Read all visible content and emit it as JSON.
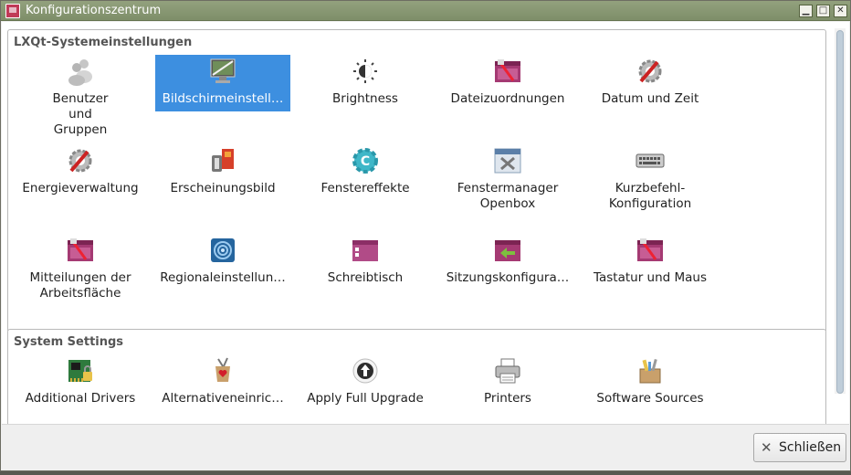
{
  "window": {
    "title": "Konfigurationszentrum",
    "buttons": {
      "minimize": "▁",
      "maximize": "□",
      "close": "✕"
    }
  },
  "sections": [
    {
      "title": "LXQt-Systemeinstellungen",
      "items": [
        {
          "label": "Benutzer und Gruppen",
          "icon": "users-icon"
        },
        {
          "label": "Bildschirmeinstell…",
          "icon": "monitor-icon",
          "selected": true
        },
        {
          "label": "Brightness",
          "icon": "brightness-icon"
        },
        {
          "label": "Dateizuordnungen",
          "icon": "preferences-icon"
        },
        {
          "label": "Datum und Zeit",
          "icon": "tools-icon"
        },
        {
          "label": "Energieverwaltung",
          "icon": "tools-icon"
        },
        {
          "label": "Erscheinungsbild",
          "icon": "appearance-icon"
        },
        {
          "label": "Fenstereffekte",
          "icon": "gear-icon"
        },
        {
          "label": "Fenstermanager Openbox",
          "icon": "window-manager-icon"
        },
        {
          "label": "Kurzbefehl-Konfiguration",
          "icon": "keyboard-icon"
        },
        {
          "label": "Mitteilungen der Arbeitsfläche",
          "icon": "preferences-icon"
        },
        {
          "label": "Regionaleinstellun…",
          "icon": "region-icon"
        },
        {
          "label": "Schreibtisch",
          "icon": "desktop-icon"
        },
        {
          "label": "Sitzungskonfigura…",
          "icon": "session-icon"
        },
        {
          "label": "Tastatur und Maus",
          "icon": "preferences-icon"
        }
      ]
    },
    {
      "title": "System Settings",
      "items": [
        {
          "label": "Additional Drivers",
          "icon": "drivers-icon"
        },
        {
          "label": "Alternativeneinric…",
          "icon": "alternatives-icon"
        },
        {
          "label": "Apply Full Upgrade",
          "icon": "upgrade-icon"
        },
        {
          "label": "Printers",
          "icon": "printer-icon"
        },
        {
          "label": "Software Sources",
          "icon": "software-sources-icon"
        }
      ]
    }
  ],
  "footer": {
    "close_label": "Schließen",
    "close_icon": "close-icon"
  }
}
